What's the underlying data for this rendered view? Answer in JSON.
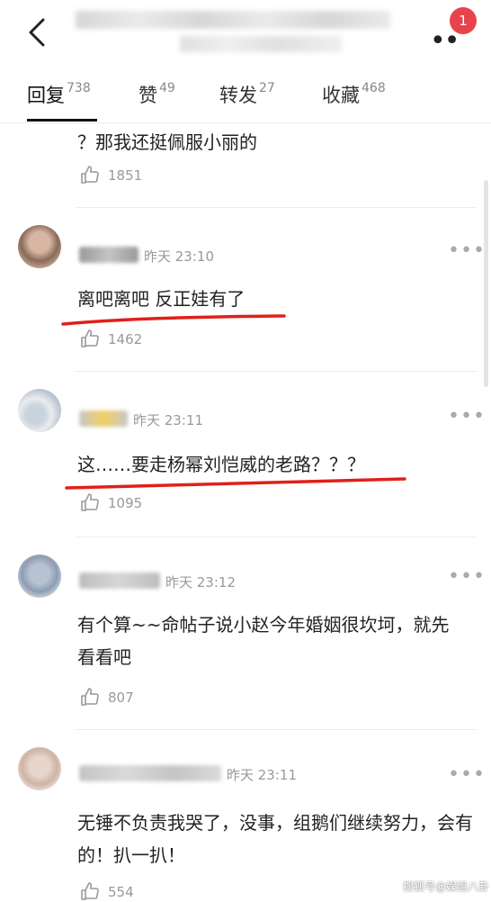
{
  "tabs": [
    {
      "label": "回复",
      "count": "738"
    },
    {
      "label": "赞",
      "count": "49"
    },
    {
      "label": "转发",
      "count": "27"
    },
    {
      "label": "收藏",
      "count": "468"
    }
  ],
  "badge": "1",
  "top_fragment": {
    "text": "？那我还挺佩服小丽的",
    "likes": "1851"
  },
  "comments": [
    {
      "time": "昨天 23:10",
      "text": "离吧离吧 反正娃有了",
      "likes": "1462"
    },
    {
      "time": "昨天 23:11",
      "text": "这……要走杨幂刘恺威的老路？？？",
      "likes": "1095"
    },
    {
      "time": "昨天 23:12",
      "text": "有个算~~命帖子说小赵今年婚姻很坎坷，就先看看吧",
      "likes": "807"
    },
    {
      "time": "昨天 23:11",
      "text": "无锤不负责我哭了，没事，组鹅们继续努力，会有的！扒一扒！",
      "likes": "554"
    }
  ],
  "watermark": "搜狐号@娱姐八卦",
  "colors": {
    "badge": "#e8434d",
    "annotation_underline": "#e0201a",
    "meta": "#999999"
  }
}
